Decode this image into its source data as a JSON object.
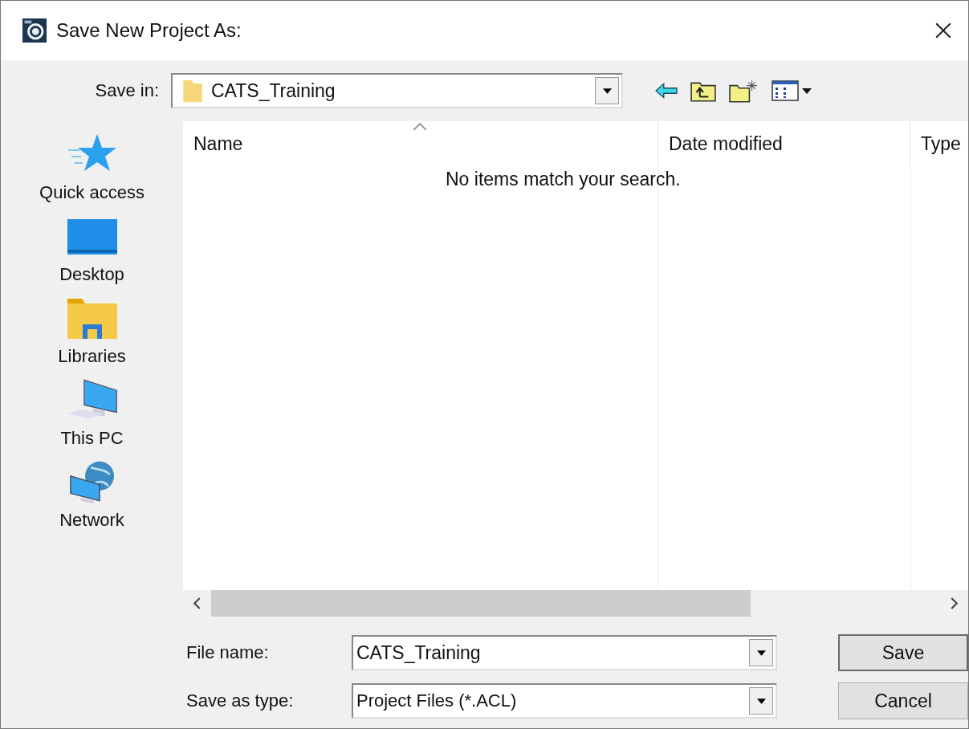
{
  "window": {
    "title": "Save New Project As:"
  },
  "save_in": {
    "label": "Save in:",
    "value": "CATS_Training"
  },
  "places": [
    {
      "label": "Quick access",
      "kind": "star"
    },
    {
      "label": "Desktop",
      "kind": "desktop"
    },
    {
      "label": "Libraries",
      "kind": "libraries"
    },
    {
      "label": "This PC",
      "kind": "pc"
    },
    {
      "label": "Network",
      "kind": "network"
    }
  ],
  "file_list": {
    "columns": [
      "Name",
      "Date modified",
      "Type"
    ],
    "empty_message": "No items match your search."
  },
  "file_name": {
    "label": "File name:",
    "value": "CATS_Training"
  },
  "save_as_type": {
    "label": "Save as type:",
    "value": "Project Files (*.ACL)"
  },
  "buttons": [
    "Save",
    "Cancel"
  ]
}
